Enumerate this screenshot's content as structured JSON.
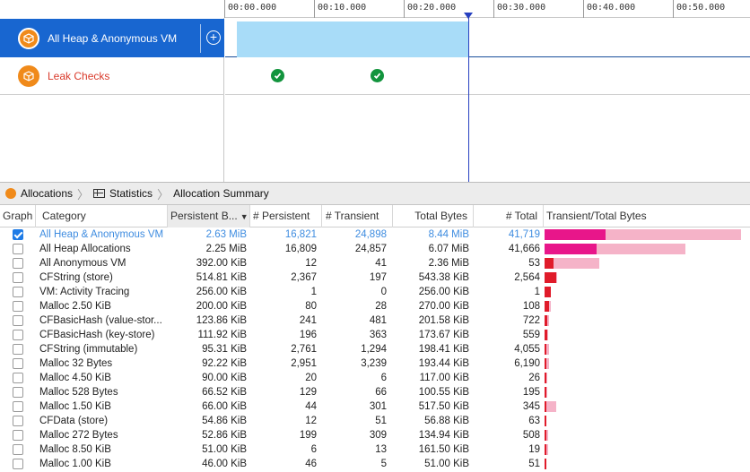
{
  "ruler": {
    "ticks": [
      "00:00.000",
      "00:10.000",
      "00:20.000",
      "00:30.000",
      "00:40.000",
      "00:50.000"
    ]
  },
  "tracks": {
    "heap_label": "All Heap & Anonymous VM",
    "leak_label": "Leak Checks",
    "add_symbol": "+"
  },
  "breadcrumb": {
    "item1": "Allocations",
    "item2": "Statistics",
    "item3": "Allocation Summary",
    "sep": "〉"
  },
  "table": {
    "headers": {
      "graph": "Graph",
      "category": "Category",
      "persistent_bytes": "Persistent B...",
      "persistent": "# Persistent",
      "transient": "# Transient",
      "total_bytes": "Total Bytes",
      "total": "# Total",
      "bar": "Transient/Total Bytes"
    },
    "max_total_bytes_mib": 8.44,
    "colors": {
      "persistent_bar": "#e8168a",
      "persistent_bar_red": "#e01b2a",
      "transient_bar": "#f5b3c8",
      "highlight_text": "#3e8ce0",
      "checkbox_on": "#1e7be6"
    },
    "rows": [
      {
        "checked": true,
        "category": "All Heap & Anonymous VM",
        "persistent_bytes": "2.63 MiB",
        "persistent": "16,821",
        "transient": "24,898",
        "total_bytes": "8.44 MiB",
        "total": "41,719",
        "persist_frac": 0.312,
        "total_frac": 1.0,
        "magenta": true
      },
      {
        "checked": false,
        "category": "All Heap Allocations",
        "persistent_bytes": "2.25 MiB",
        "persistent": "16,809",
        "transient": "24,857",
        "total_bytes": "6.07 MiB",
        "total": "41,666",
        "persist_frac": 0.267,
        "total_frac": 0.719,
        "magenta": true
      },
      {
        "checked": false,
        "category": "All Anonymous VM",
        "persistent_bytes": "392.00 KiB",
        "persistent": "12",
        "transient": "41",
        "total_bytes": "2.36 MiB",
        "total": "53",
        "persist_frac": 0.045,
        "total_frac": 0.28,
        "magenta": false
      },
      {
        "checked": false,
        "category": "CFString (store)",
        "persistent_bytes": "514.81 KiB",
        "persistent": "2,367",
        "transient": "197",
        "total_bytes": "543.38 KiB",
        "total": "2,564",
        "persist_frac": 0.06,
        "total_frac": 0.063,
        "magenta": false
      },
      {
        "checked": false,
        "category": "VM: Activity Tracing",
        "persistent_bytes": "256.00 KiB",
        "persistent": "1",
        "transient": "0",
        "total_bytes": "256.00 KiB",
        "total": "1",
        "persist_frac": 0.03,
        "total_frac": 0.03,
        "magenta": false
      },
      {
        "checked": false,
        "category": "Malloc 2.50 KiB",
        "persistent_bytes": "200.00 KiB",
        "persistent": "80",
        "transient": "28",
        "total_bytes": "270.00 KiB",
        "total": "108",
        "persist_frac": 0.023,
        "total_frac": 0.031,
        "magenta": false
      },
      {
        "checked": false,
        "category": "CFBasicHash (value-stor...",
        "persistent_bytes": "123.86 KiB",
        "persistent": "241",
        "transient": "481",
        "total_bytes": "201.58 KiB",
        "total": "722",
        "persist_frac": 0.015,
        "total_frac": 0.023,
        "magenta": false
      },
      {
        "checked": false,
        "category": "CFBasicHash (key-store)",
        "persistent_bytes": "111.92 KiB",
        "persistent": "196",
        "transient": "363",
        "total_bytes": "173.67 KiB",
        "total": "559",
        "persist_frac": 0.013,
        "total_frac": 0.02,
        "magenta": false
      },
      {
        "checked": false,
        "category": "CFString (immutable)",
        "persistent_bytes": "95.31 KiB",
        "persistent": "2,761",
        "transient": "1,294",
        "total_bytes": "198.41 KiB",
        "total": "4,055",
        "persist_frac": 0.011,
        "total_frac": 0.023,
        "magenta": false
      },
      {
        "checked": false,
        "category": "Malloc 32 Bytes",
        "persistent_bytes": "92.22 KiB",
        "persistent": "2,951",
        "transient": "3,239",
        "total_bytes": "193.44 KiB",
        "total": "6,190",
        "persist_frac": 0.011,
        "total_frac": 0.022,
        "magenta": false
      },
      {
        "checked": false,
        "category": "Malloc 4.50 KiB",
        "persistent_bytes": "90.00 KiB",
        "persistent": "20",
        "transient": "6",
        "total_bytes": "117.00 KiB",
        "total": "26",
        "persist_frac": 0.01,
        "total_frac": 0.014,
        "magenta": false
      },
      {
        "checked": false,
        "category": "Malloc 528 Bytes",
        "persistent_bytes": "66.52 KiB",
        "persistent": "129",
        "transient": "66",
        "total_bytes": "100.55 KiB",
        "total": "195",
        "persist_frac": 0.008,
        "total_frac": 0.012,
        "magenta": false
      },
      {
        "checked": false,
        "category": "Malloc 1.50 KiB",
        "persistent_bytes": "66.00 KiB",
        "persistent": "44",
        "transient": "301",
        "total_bytes": "517.50 KiB",
        "total": "345",
        "persist_frac": 0.008,
        "total_frac": 0.06,
        "magenta": false
      },
      {
        "checked": false,
        "category": "CFData (store)",
        "persistent_bytes": "54.86 KiB",
        "persistent": "12",
        "transient": "51",
        "total_bytes": "56.88 KiB",
        "total": "63",
        "persist_frac": 0.006,
        "total_frac": 0.007,
        "magenta": false
      },
      {
        "checked": false,
        "category": "Malloc 272 Bytes",
        "persistent_bytes": "52.86 KiB",
        "persistent": "199",
        "transient": "309",
        "total_bytes": "134.94 KiB",
        "total": "508",
        "persist_frac": 0.006,
        "total_frac": 0.016,
        "magenta": false
      },
      {
        "checked": false,
        "category": "Malloc 8.50 KiB",
        "persistent_bytes": "51.00 KiB",
        "persistent": "6",
        "transient": "13",
        "total_bytes": "161.50 KiB",
        "total": "19",
        "persist_frac": 0.006,
        "total_frac": 0.019,
        "magenta": false
      },
      {
        "checked": false,
        "category": "Malloc 1.00 KiB",
        "persistent_bytes": "46.00 KiB",
        "persistent": "46",
        "transient": "5",
        "total_bytes": "51.00 KiB",
        "total": "51",
        "persist_frac": 0.005,
        "total_frac": 0.006,
        "magenta": false
      }
    ]
  }
}
